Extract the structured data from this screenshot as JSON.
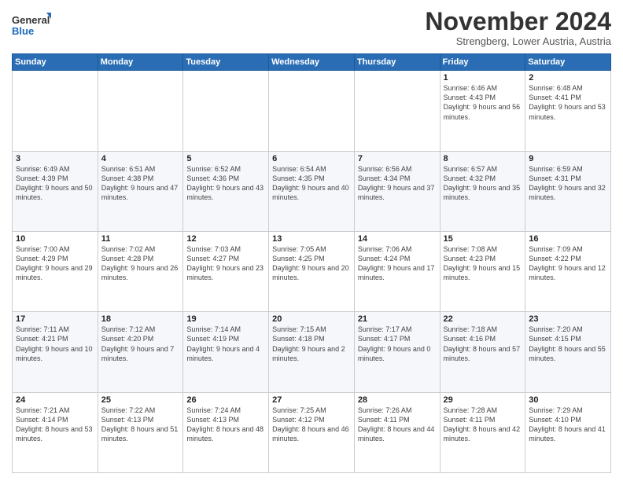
{
  "logo": {
    "line1": "General",
    "line2": "Blue"
  },
  "title": "November 2024",
  "subtitle": "Strengberg, Lower Austria, Austria",
  "days_header": [
    "Sunday",
    "Monday",
    "Tuesday",
    "Wednesday",
    "Thursday",
    "Friday",
    "Saturday"
  ],
  "weeks": [
    [
      {
        "day": "",
        "info": ""
      },
      {
        "day": "",
        "info": ""
      },
      {
        "day": "",
        "info": ""
      },
      {
        "day": "",
        "info": ""
      },
      {
        "day": "",
        "info": ""
      },
      {
        "day": "1",
        "info": "Sunrise: 6:46 AM\nSunset: 4:43 PM\nDaylight: 9 hours and 56 minutes."
      },
      {
        "day": "2",
        "info": "Sunrise: 6:48 AM\nSunset: 4:41 PM\nDaylight: 9 hours and 53 minutes."
      }
    ],
    [
      {
        "day": "3",
        "info": "Sunrise: 6:49 AM\nSunset: 4:39 PM\nDaylight: 9 hours and 50 minutes."
      },
      {
        "day": "4",
        "info": "Sunrise: 6:51 AM\nSunset: 4:38 PM\nDaylight: 9 hours and 47 minutes."
      },
      {
        "day": "5",
        "info": "Sunrise: 6:52 AM\nSunset: 4:36 PM\nDaylight: 9 hours and 43 minutes."
      },
      {
        "day": "6",
        "info": "Sunrise: 6:54 AM\nSunset: 4:35 PM\nDaylight: 9 hours and 40 minutes."
      },
      {
        "day": "7",
        "info": "Sunrise: 6:56 AM\nSunset: 4:34 PM\nDaylight: 9 hours and 37 minutes."
      },
      {
        "day": "8",
        "info": "Sunrise: 6:57 AM\nSunset: 4:32 PM\nDaylight: 9 hours and 35 minutes."
      },
      {
        "day": "9",
        "info": "Sunrise: 6:59 AM\nSunset: 4:31 PM\nDaylight: 9 hours and 32 minutes."
      }
    ],
    [
      {
        "day": "10",
        "info": "Sunrise: 7:00 AM\nSunset: 4:29 PM\nDaylight: 9 hours and 29 minutes."
      },
      {
        "day": "11",
        "info": "Sunrise: 7:02 AM\nSunset: 4:28 PM\nDaylight: 9 hours and 26 minutes."
      },
      {
        "day": "12",
        "info": "Sunrise: 7:03 AM\nSunset: 4:27 PM\nDaylight: 9 hours and 23 minutes."
      },
      {
        "day": "13",
        "info": "Sunrise: 7:05 AM\nSunset: 4:25 PM\nDaylight: 9 hours and 20 minutes."
      },
      {
        "day": "14",
        "info": "Sunrise: 7:06 AM\nSunset: 4:24 PM\nDaylight: 9 hours and 17 minutes."
      },
      {
        "day": "15",
        "info": "Sunrise: 7:08 AM\nSunset: 4:23 PM\nDaylight: 9 hours and 15 minutes."
      },
      {
        "day": "16",
        "info": "Sunrise: 7:09 AM\nSunset: 4:22 PM\nDaylight: 9 hours and 12 minutes."
      }
    ],
    [
      {
        "day": "17",
        "info": "Sunrise: 7:11 AM\nSunset: 4:21 PM\nDaylight: 9 hours and 10 minutes."
      },
      {
        "day": "18",
        "info": "Sunrise: 7:12 AM\nSunset: 4:20 PM\nDaylight: 9 hours and 7 minutes."
      },
      {
        "day": "19",
        "info": "Sunrise: 7:14 AM\nSunset: 4:19 PM\nDaylight: 9 hours and 4 minutes."
      },
      {
        "day": "20",
        "info": "Sunrise: 7:15 AM\nSunset: 4:18 PM\nDaylight: 9 hours and 2 minutes."
      },
      {
        "day": "21",
        "info": "Sunrise: 7:17 AM\nSunset: 4:17 PM\nDaylight: 9 hours and 0 minutes."
      },
      {
        "day": "22",
        "info": "Sunrise: 7:18 AM\nSunset: 4:16 PM\nDaylight: 8 hours and 57 minutes."
      },
      {
        "day": "23",
        "info": "Sunrise: 7:20 AM\nSunset: 4:15 PM\nDaylight: 8 hours and 55 minutes."
      }
    ],
    [
      {
        "day": "24",
        "info": "Sunrise: 7:21 AM\nSunset: 4:14 PM\nDaylight: 8 hours and 53 minutes."
      },
      {
        "day": "25",
        "info": "Sunrise: 7:22 AM\nSunset: 4:13 PM\nDaylight: 8 hours and 51 minutes."
      },
      {
        "day": "26",
        "info": "Sunrise: 7:24 AM\nSunset: 4:13 PM\nDaylight: 8 hours and 48 minutes."
      },
      {
        "day": "27",
        "info": "Sunrise: 7:25 AM\nSunset: 4:12 PM\nDaylight: 8 hours and 46 minutes."
      },
      {
        "day": "28",
        "info": "Sunrise: 7:26 AM\nSunset: 4:11 PM\nDaylight: 8 hours and 44 minutes."
      },
      {
        "day": "29",
        "info": "Sunrise: 7:28 AM\nSunset: 4:11 PM\nDaylight: 8 hours and 42 minutes."
      },
      {
        "day": "30",
        "info": "Sunrise: 7:29 AM\nSunset: 4:10 PM\nDaylight: 8 hours and 41 minutes."
      }
    ]
  ]
}
